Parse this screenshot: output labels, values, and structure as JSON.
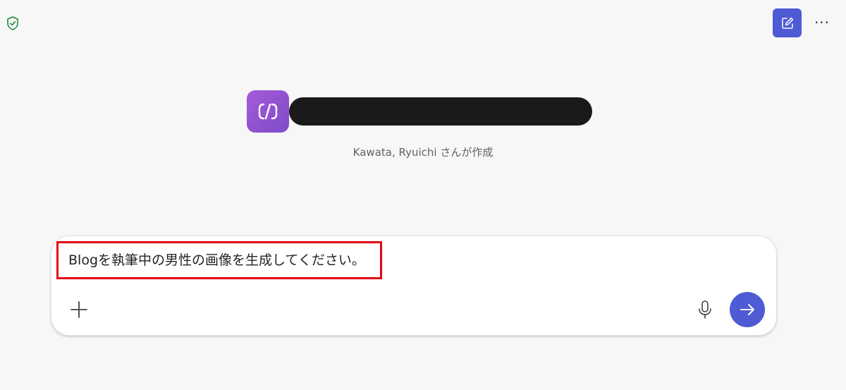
{
  "header": {
    "shield_icon": "shield-check-icon",
    "new_chat_icon": "compose-icon",
    "more_label": "···",
    "accent_color": "#4f5bd5"
  },
  "agent": {
    "name": "",
    "creator_text": "Kawata, Ryuichi さんが作成",
    "logo_icon": "code-slash-icon",
    "logo_gradient": [
      "#a55bd9",
      "#7e4bc8"
    ]
  },
  "composer": {
    "input_value": "Blogを執筆中の男性の画像を生成してください。",
    "highlight_color": "#e30613",
    "plus_icon": "plus-icon",
    "mic_icon": "microphone-icon",
    "send_icon": "arrow-right-icon"
  }
}
